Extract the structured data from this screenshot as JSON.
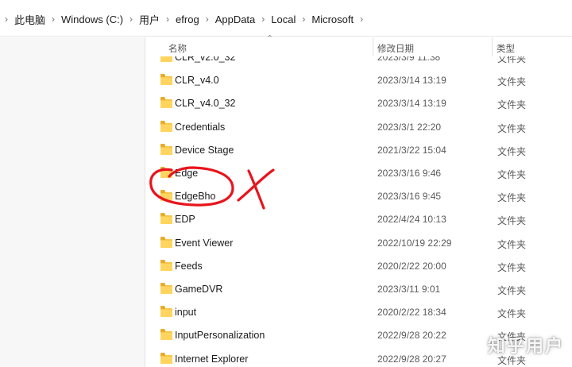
{
  "breadcrumb": [
    "此电脑",
    "Windows (C:)",
    "用户",
    "efrog",
    "AppData",
    "Local",
    "Microsoft"
  ],
  "columns": {
    "name": "名称",
    "date": "修改日期",
    "type": "类型"
  },
  "files": [
    {
      "name": "CLR_v2.0_32",
      "date": "2023/3/9 11:38",
      "type": "文件夹"
    },
    {
      "name": "CLR_v4.0",
      "date": "2023/3/14 13:19",
      "type": "文件夹"
    },
    {
      "name": "CLR_v4.0_32",
      "date": "2023/3/14 13:19",
      "type": "文件夹"
    },
    {
      "name": "Credentials",
      "date": "2023/3/1 22:20",
      "type": "文件夹"
    },
    {
      "name": "Device Stage",
      "date": "2021/3/22 15:04",
      "type": "文件夹"
    },
    {
      "name": "Edge",
      "date": "2023/3/16 9:46",
      "type": "文件夹"
    },
    {
      "name": "EdgeBho",
      "date": "2023/3/16 9:45",
      "type": "文件夹"
    },
    {
      "name": "EDP",
      "date": "2022/4/24 10:13",
      "type": "文件夹"
    },
    {
      "name": "Event Viewer",
      "date": "2022/10/19 22:29",
      "type": "文件夹"
    },
    {
      "name": "Feeds",
      "date": "2020/2/22 20:00",
      "type": "文件夹"
    },
    {
      "name": "GameDVR",
      "date": "2023/3/11 9:01",
      "type": "文件夹"
    },
    {
      "name": "input",
      "date": "2020/2/22 18:34",
      "type": "文件夹"
    },
    {
      "name": "InputPersonalization",
      "date": "2022/9/28 20:22",
      "type": "文件夹"
    },
    {
      "name": "Internet Explorer",
      "date": "2022/9/28 20:27",
      "type": "文件夹"
    }
  ],
  "annotation_color": "#e8141c",
  "icons": {
    "folder": "folder-icon",
    "separator": "chevron-right-icon",
    "sort": "sort-up-icon"
  },
  "watermark": "知乎用户"
}
